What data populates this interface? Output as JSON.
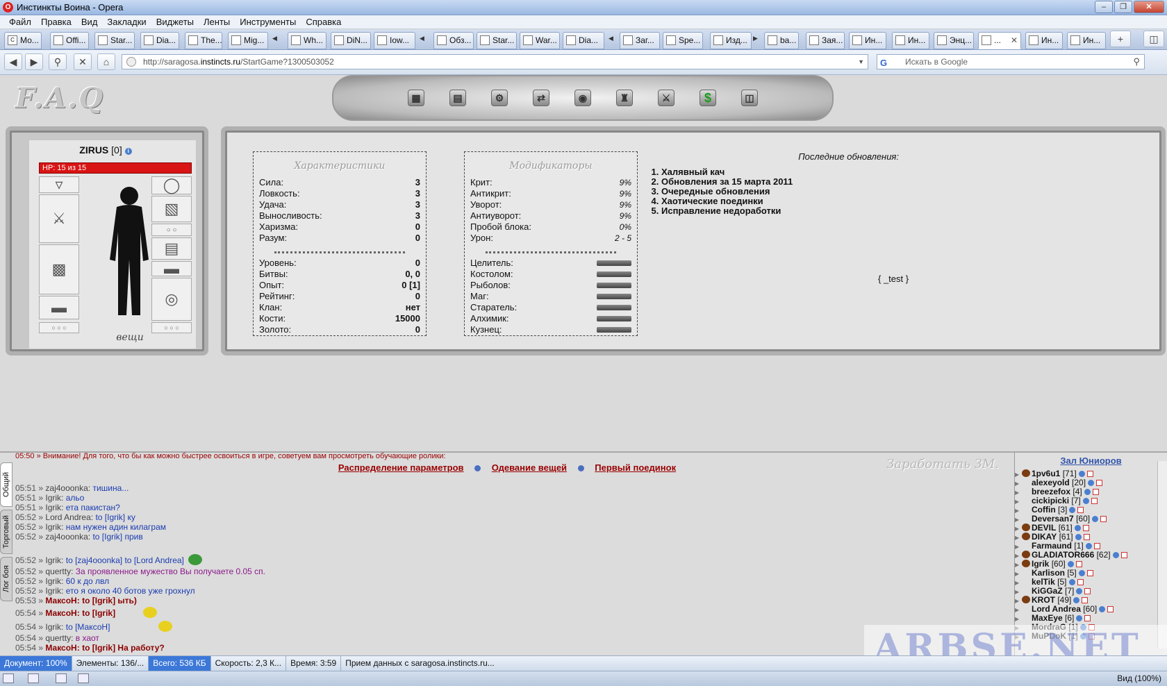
{
  "window": {
    "title": "Инстинкты Воина - Opera",
    "logo": "O"
  },
  "menu": [
    "Файл",
    "Правка",
    "Вид",
    "Закладки",
    "Виджеты",
    "Ленты",
    "Инструменты",
    "Справка"
  ],
  "tabs": [
    "Мо...",
    "Offi...",
    "Star...",
    "Dia...",
    "The...",
    "Mig...",
    "Wh...",
    "DiN...",
    "Iow...",
    "Обз...",
    "Star...",
    "War...",
    "Dia...",
    "Заг...",
    "Spe...",
    "Изд...",
    "ba...",
    "Зая...",
    "Ин...",
    "Ин...",
    "Энц...",
    "...",
    "Ин...",
    "Ин..."
  ],
  "address": {
    "prefix": "http://saragosa.",
    "domain": "instincts.ru",
    "suffix": "/StartGame?1300503052",
    "search_placeholder": "Искать в Google"
  },
  "game": {
    "faq_logo": "F.A.Q",
    "dollar_icon": "$",
    "character": {
      "name": "ZIRUS",
      "level": "[0]",
      "hp": "HP: 15 из 15",
      "things": "вещи"
    },
    "characteristics": {
      "title": "Характеристики",
      "rows": [
        {
          "label": "Сила:",
          "value": "3"
        },
        {
          "label": "Ловкость:",
          "value": "3"
        },
        {
          "label": "Удача:",
          "value": "3"
        },
        {
          "label": "Выносливость:",
          "value": "3"
        },
        {
          "label": "Харизма:",
          "value": "0"
        },
        {
          "label": "Разум:",
          "value": "0"
        }
      ],
      "rows2": [
        {
          "label": "Уровень:",
          "value": "0"
        },
        {
          "label": "Битвы:",
          "value": "0, 0"
        },
        {
          "label": "Опыт:",
          "value": "0 [1]"
        },
        {
          "label": "Рейтинг:",
          "value": "0"
        },
        {
          "label": "Клан:",
          "value": "нет"
        },
        {
          "label": "Кости:",
          "value": "15000"
        },
        {
          "label": "Золото:",
          "value": "0"
        }
      ]
    },
    "modifiers": {
      "title": "Модификаторы",
      "rows": [
        {
          "label": "Крит:",
          "value": "9%"
        },
        {
          "label": "Антикрит:",
          "value": "9%"
        },
        {
          "label": "Уворот:",
          "value": "9%"
        },
        {
          "label": "Антиуворот:",
          "value": "9%"
        },
        {
          "label": "Пробой блока:",
          "value": "0%"
        },
        {
          "label": "Урон:",
          "value": "2 - 5"
        }
      ],
      "skills": [
        "Целитель:",
        "Костолом:",
        "Рыболов:",
        "Маг:",
        "Старатель:",
        "Алхимик:",
        "Кузнец:"
      ]
    },
    "updates": {
      "title": "Последние обновления:",
      "items": [
        "Халявный кач",
        "Обновления за 15 марта 2011",
        "Очередные обновления",
        "Хаотические поединки",
        "Исправление недоработки"
      ]
    },
    "test_label": "{ _test }"
  },
  "chat": {
    "tabs": [
      "Общий",
      "Торговый",
      "Лог боя"
    ],
    "top_line": "05:50 » Внимание! Для того, что бы как можно быстрее освоиться в игре, советуем вам просмотреть обучающие ролики:",
    "links": [
      "Распределение параметров",
      "Одевание вещей",
      "Первый поединок"
    ],
    "earn": "Заработать ЗМ.",
    "messages": [
      {
        "time": "05:51 »",
        "nick": "zaj4ooonka:",
        "text": "тишина..."
      },
      {
        "time": "05:51 »",
        "nick": "Igrik:",
        "text": "альо"
      },
      {
        "time": "05:51 »",
        "nick": "Igrik:",
        "text": "ета пакистан?"
      },
      {
        "time": "05:52 »",
        "nick": "Lord Andrea:",
        "text": "to [Igrik] ку"
      },
      {
        "time": "05:52 »",
        "nick": "Igrik:",
        "text": "нам нужен адин килаграм"
      },
      {
        "time": "05:52 »",
        "nick": "zaj4ooonka:",
        "text": "to [Igrik] прив"
      },
      {
        "time": "05:52 »",
        "nick": "Igrik:",
        "text": "to [zaj4ooonka] to [Lord Andrea]"
      },
      {
        "time": "05:52 »",
        "nick": "quertty:",
        "text": "За проявленное мужество Вы получаете 0.05 сп."
      },
      {
        "time": "05:52 »",
        "nick": "Igrik:",
        "text": "60 к до лвл"
      },
      {
        "time": "05:52 »",
        "nick": "Igrik:",
        "text": "ето я около 40 ботов уже грохнул"
      },
      {
        "time": "05:53 »",
        "nick": "МаксоН:",
        "text": "to [Igrik] ыть)"
      },
      {
        "time": "05:54 »",
        "nick": "МаксоН:",
        "text": "to [Igrik]"
      },
      {
        "time": "05:54 »",
        "nick": "Igrik:",
        "text": "to [МаксоН]"
      },
      {
        "time": "05:54 »",
        "nick": "quertty:",
        "text": "в хаот"
      },
      {
        "time": "05:54 »",
        "nick": "МаксоН:",
        "text": "to [Igrik] На работу?"
      }
    ]
  },
  "users": {
    "title": "Зал Юниоров",
    "list": [
      {
        "name": "1pv6u1",
        "lvl": "[71]"
      },
      {
        "name": "alexeyold",
        "lvl": "[20]"
      },
      {
        "name": "breezefox",
        "lvl": "[4]"
      },
      {
        "name": "cickipicki",
        "lvl": "[7]"
      },
      {
        "name": "Coffin",
        "lvl": "[3]"
      },
      {
        "name": "Deversan7",
        "lvl": "[60]"
      },
      {
        "name": "DEVIL",
        "lvl": "[61]"
      },
      {
        "name": "DIKAY",
        "lvl": "[61]"
      },
      {
        "name": "Farmaund",
        "lvl": "[1]"
      },
      {
        "name": "GLADIATOR666",
        "lvl": "[62]"
      },
      {
        "name": "Igrik",
        "lvl": "[60]"
      },
      {
        "name": "Karlison",
        "lvl": "[5]"
      },
      {
        "name": "kelTik",
        "lvl": "[5]"
      },
      {
        "name": "KiGGaZ",
        "lvl": "[7]"
      },
      {
        "name": "KROT",
        "lvl": "[49]"
      },
      {
        "name": "Lord Andrea",
        "lvl": "[60]"
      },
      {
        "name": "MaxEye",
        "lvl": "[6]"
      },
      {
        "name": "MordraG",
        "lvl": "[1]"
      },
      {
        "name": "MuPDoK",
        "lvl": "[1]"
      }
    ]
  },
  "watermark": "ARBSE.NET",
  "status": {
    "doc": "Документ:",
    "doc_pct": "100%",
    "elements": "Элементы:  136/...",
    "total": "Всего:  536 КБ",
    "speed": "Скорость:  2,3 К...",
    "time": "Время:  3:59",
    "receiving": "Прием данных с saragosa.instincts.ru...",
    "zoom": "Вид (100%)"
  }
}
